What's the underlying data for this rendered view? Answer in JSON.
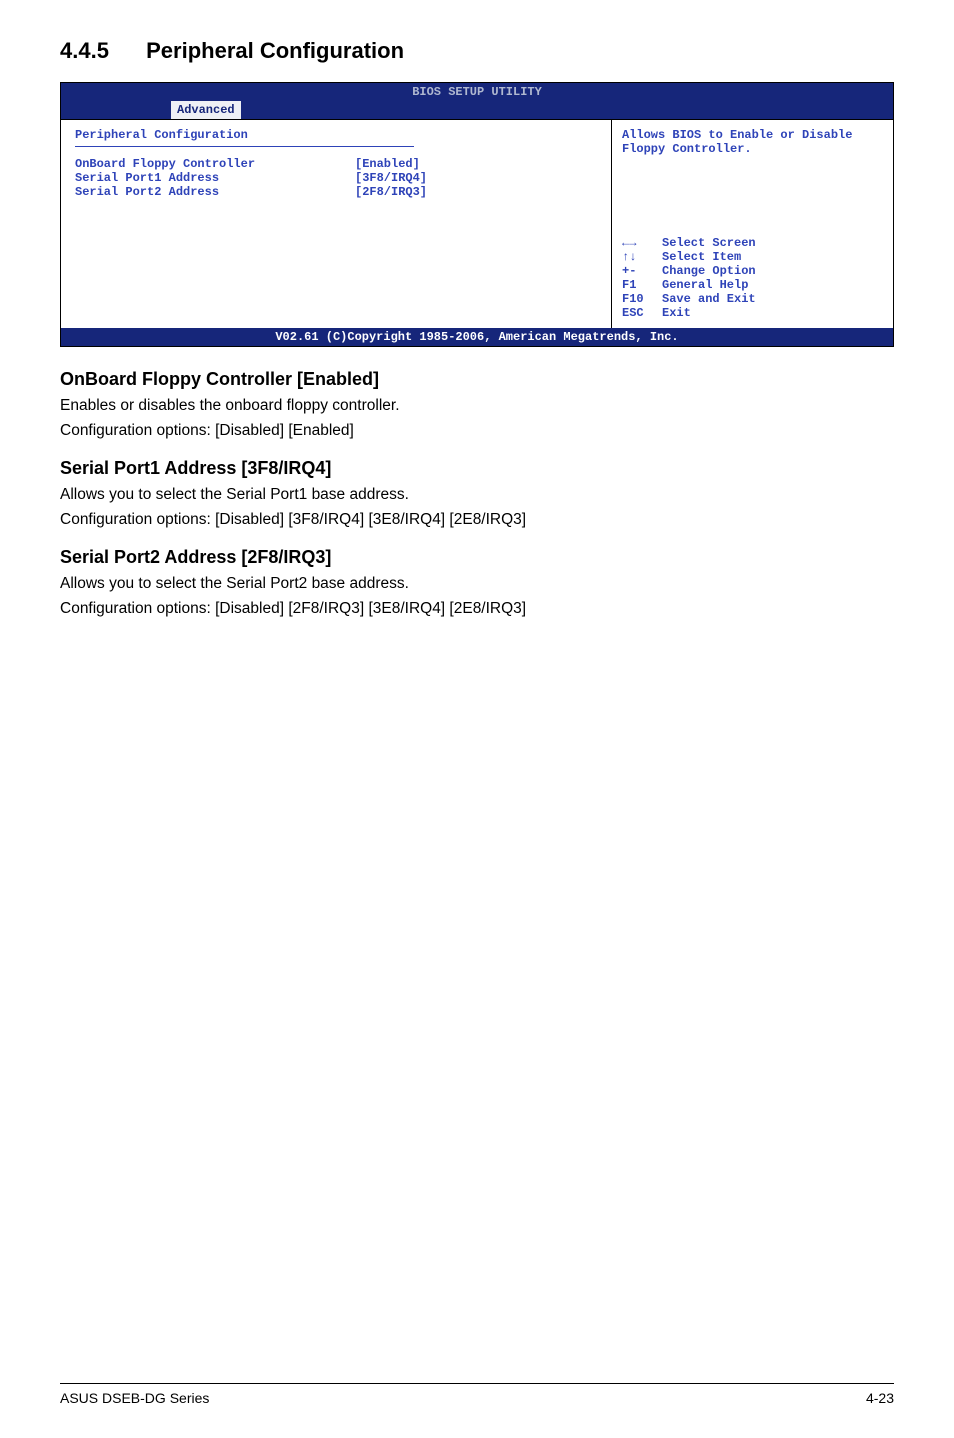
{
  "heading": {
    "number": "4.4.5",
    "title": "Peripheral Configuration"
  },
  "bios": {
    "utility_title": "BIOS SETUP UTILITY",
    "tab": "Advanced",
    "panel_title": "Peripheral Configuration",
    "rows": [
      {
        "label": "OnBoard Floppy Controller",
        "value": "[Enabled]"
      },
      {
        "label": "Serial Port1 Address",
        "value": "[3F8/IRQ4]"
      },
      {
        "label": "Serial Port2 Address",
        "value": "[2F8/IRQ3]"
      }
    ],
    "help_text": "Allows BIOS to Enable or Disable Floppy Controller.",
    "nav": [
      {
        "key": "←→",
        "action": "Select Screen"
      },
      {
        "key": "↑↓",
        "action": "Select Item"
      },
      {
        "key": "+-",
        "action": "Change Option"
      },
      {
        "key": "F1",
        "action": "General Help"
      },
      {
        "key": "F10",
        "action": "Save and Exit"
      },
      {
        "key": "ESC",
        "action": "Exit"
      }
    ],
    "copyright": "V02.61 (C)Copyright 1985-2006, American Megatrends, Inc."
  },
  "sections": [
    {
      "title": "OnBoard Floppy Controller [Enabled]",
      "line1": "Enables or disables the onboard floppy controller.",
      "line2": "Configuration options: [Disabled] [Enabled]"
    },
    {
      "title": "Serial Port1 Address [3F8/IRQ4]",
      "line1": "Allows you to select the Serial Port1 base address.",
      "line2": "Configuration options: [Disabled] [3F8/IRQ4] [3E8/IRQ4] [2E8/IRQ3]"
    },
    {
      "title": "Serial Port2 Address [2F8/IRQ3]",
      "line1": "Allows you to select the Serial Port2 base address.",
      "line2": "Configuration options: [Disabled] [2F8/IRQ3] [3E8/IRQ4] [2E8/IRQ3]"
    }
  ],
  "footer": {
    "left": "ASUS DSEB-DG Series",
    "right": "4-23"
  }
}
